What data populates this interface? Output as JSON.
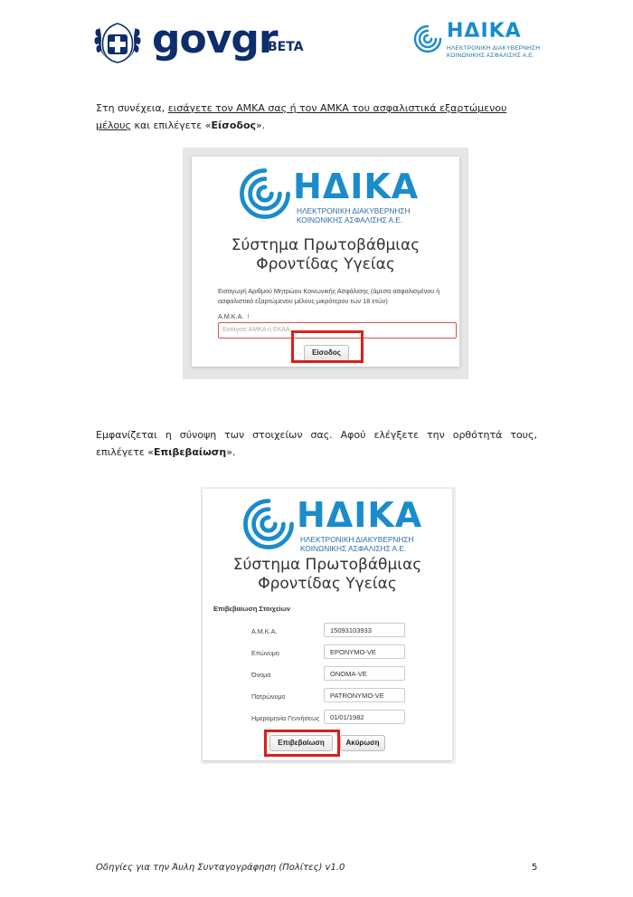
{
  "header": {
    "govgr_logo": "govgr",
    "beta_badge": "BETA",
    "idika_logo": "ΗΔΙΚΑ",
    "idika_sub_line1": "ΗΛΕΚΤΡΟΝΙΚΗ ΔΙΑΚΥΒΕΡΝΗΣΗ",
    "idika_sub_line2": "ΚΟΙΝΩΝΙΚΗΣ ΑΣΦΑΛΙΣΗΣ Α.Ε."
  },
  "para1": {
    "prefix": "Στη συνέχεια, ",
    "underlined": "εισάγετε τον ΑΜΚΑ σας ή τον ΑΜΚΑ του ασφαλιστικά εξαρτώμενου μέλους",
    "middle": " και επιλέγετε «",
    "bold": "Είσοδος",
    "suffix": "»."
  },
  "shot1": {
    "brand": "ΗΔΙΚΑ",
    "brand_line1": "ΗΛΕΚΤΡΟΝΙΚΗ ΔΙΑΚΥΒΕΡΝΗΣΗ",
    "brand_line2": "ΚΟΙΝΩΝΙΚΗΣ ΑΣΦΑΛΙΣΗΣ Α.Ε.",
    "system_line1": "Σύστημα Πρωτοβάθμιας",
    "system_line2": "Φροντίδας Υγείας",
    "intro": "Εισαγωγή Αριθμού Μητρώου Κοινωνικής Ασφάλισης (άμεσα ασφαλισμένου ή ασφαλιστικά εξαρτώμενου μέλους μικρότερου των 18 ετών)",
    "amka_label": "Α.Μ.Κ.Α.",
    "required_mark": "!",
    "amka_placeholder": "Εισάγετε ΑΜΚΑ ή ΕΚΑΑ...",
    "login_button": "Είσοδος"
  },
  "para2": {
    "text": "Εμφανίζεται η σύνοψη των στοιχείων σας. Αφού ελέγξετε την ορθότητά τους, επιλέγετε «",
    "bold": "Επιβεβαίωση",
    "suffix": "»."
  },
  "shot2": {
    "brand": "ΗΔΙΚΑ",
    "brand_line1": "ΗΛΕΚΤΡΟΝΙΚΗ ΔΙΑΚΥΒΕΡΝΗΣΗ",
    "brand_line2": "ΚΟΙΝΩΝΙΚΗΣ ΑΣΦΑΛΙΣΗΣ Α.Ε.",
    "system_line1": "Σύστημα Πρωτοβάθμιας",
    "system_line2": "Φροντίδας Υγείας",
    "section_title": "Επιβεβαίωση Στοιχείων",
    "rows": [
      {
        "label": "Α.Μ.Κ.Α.",
        "value": "15093103933"
      },
      {
        "label": "Επώνυμο",
        "value": "EPONYMO-VE"
      },
      {
        "label": "Όνομα",
        "value": "ONOMA-VE"
      },
      {
        "label": "Πατρώνυμο",
        "value": "PATRONYMO-VE"
      },
      {
        "label": "Ημερομηνία Γεννήσεως",
        "value": "01/01/1982"
      }
    ],
    "confirm_button": "Επιβεβαίωση",
    "cancel_button": "Ακύρωση"
  },
  "footer": {
    "title": "Οδηγίες για την Άυλη Συνταγογράφηση (Πολίτες) v1.0",
    "page_number": "5"
  },
  "colors": {
    "govgr_navy": "#0d2d6b",
    "idika_blue": "#1a8ccb",
    "highlight_red": "#d9201c"
  }
}
